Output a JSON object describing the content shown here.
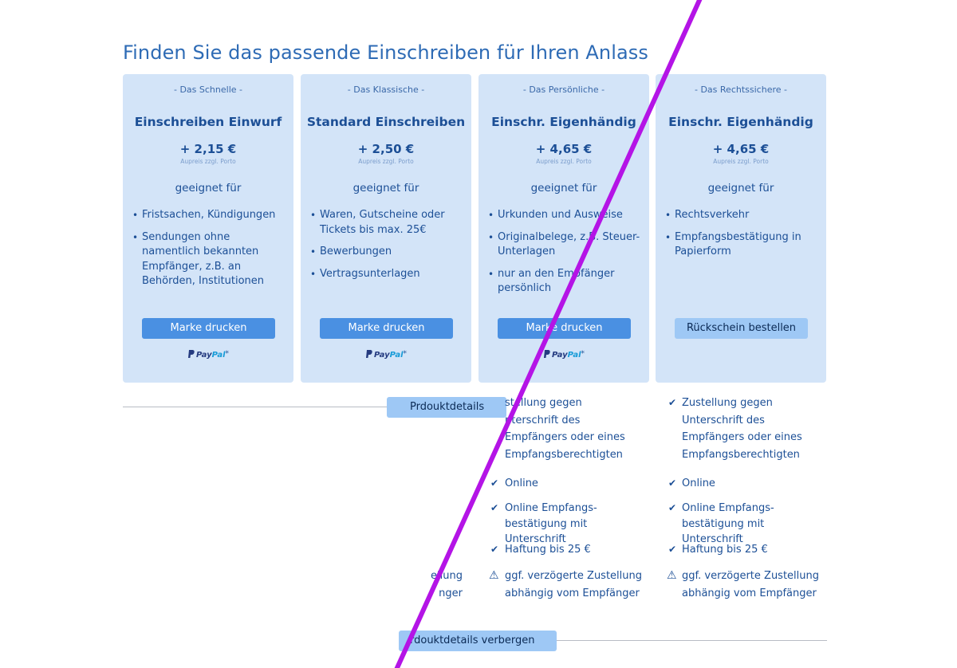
{
  "page": {
    "title": "Finden Sie das passende Einschreiben für Ihren Anlass"
  },
  "cards": [
    {
      "tag": "- Das Schnelle -",
      "name": "Einschreiben Einwurf",
      "price": "+ 2,15 €",
      "price_note": "Aupreis zzgl. Porto",
      "suited": "geeignet für",
      "items": [
        "Fristsachen, Kündigungen",
        "Sendungen ohne namentlich bekannten Empfänger, z.B. an Behörden, Institutionen"
      ],
      "button": "Marke drucken",
      "paypal": {
        "pay": "Pay",
        "pal": "Pal",
        "star": "*"
      }
    },
    {
      "tag": "- Das Klassische -",
      "name": "Standard Einschreiben",
      "price": "+ 2,50 €",
      "price_note": "Aupreis zzgl. Porto",
      "suited": "geeignet für",
      "items": [
        "Waren, Gutscheine oder Tickets bis max. 25€",
        "Bewerbungen",
        "Vertragsunterlagen"
      ],
      "button": "Marke drucken",
      "paypal": {
        "pay": "Pay",
        "pal": "Pal",
        "star": "*"
      }
    },
    {
      "tag": "- Das Persönliche -",
      "name": "Einschr. Eigenhändig",
      "price": "+ 4,65 €",
      "price_note": "Aupreis zzgl. Porto",
      "suited": "geeignet für",
      "items": [
        "Urkunden und Ausweise",
        "Originalbelege, z.B. Steuer-Unterlagen",
        "nur an den Empfänger persönlich"
      ],
      "button": "Marke drucken",
      "paypal": {
        "pay": "Pay",
        "pal": "Pal",
        "star": "*"
      }
    },
    {
      "tag": "- Das Rechtssichere -",
      "name": "Einschr. Eigenhändig",
      "price": "+ 4,65 €",
      "price_note": "Aupreis zzgl. Porto",
      "suited": "geeignet für",
      "items": [
        "Rechtsverkehr",
        "Empfangsbestätigung in Papierform"
      ],
      "button": "Rückschein bestellen"
    }
  ],
  "details_show": "Prdouktdetails anzei",
  "details_hide": "rdouktdetails verbergen",
  "features_col3": {
    "delivery": [
      "stellung gegen",
      "nterschrift des",
      "Empfängers oder eines",
      "Empfangsberechtigten"
    ],
    "online": "Online",
    "receipt": [
      "Online Empfangs-",
      "bestätigung mit",
      "Unterschrift"
    ],
    "liability": "Haftung bis 25 €",
    "warning": [
      "ggf. verzögerte Zustellung",
      "abhängig vom Empfänger"
    ]
  },
  "features_col4": {
    "delivery": [
      "Zustellung gegen",
      "Unterschrift des",
      "Empfängers oder eines",
      "Empfangsberechtigten"
    ],
    "online": "Online",
    "receipt": [
      "Online Empfangs-",
      "bestätigung mit",
      "Unterschrift"
    ],
    "liability": "Haftung bis 25 €",
    "warning": [
      "ggf. verzögerte Zustellung",
      "abhängig vom Empfänger"
    ]
  },
  "features_col2_fragment": [
    "ellung",
    "nger"
  ],
  "colors": {
    "card_bg": "#d3e4f8",
    "button": "#4a90e2",
    "button_light": "#9ec8f5",
    "text": "#1c4f96",
    "title": "#2e6bb5",
    "overlay_line": "#b414e6"
  }
}
